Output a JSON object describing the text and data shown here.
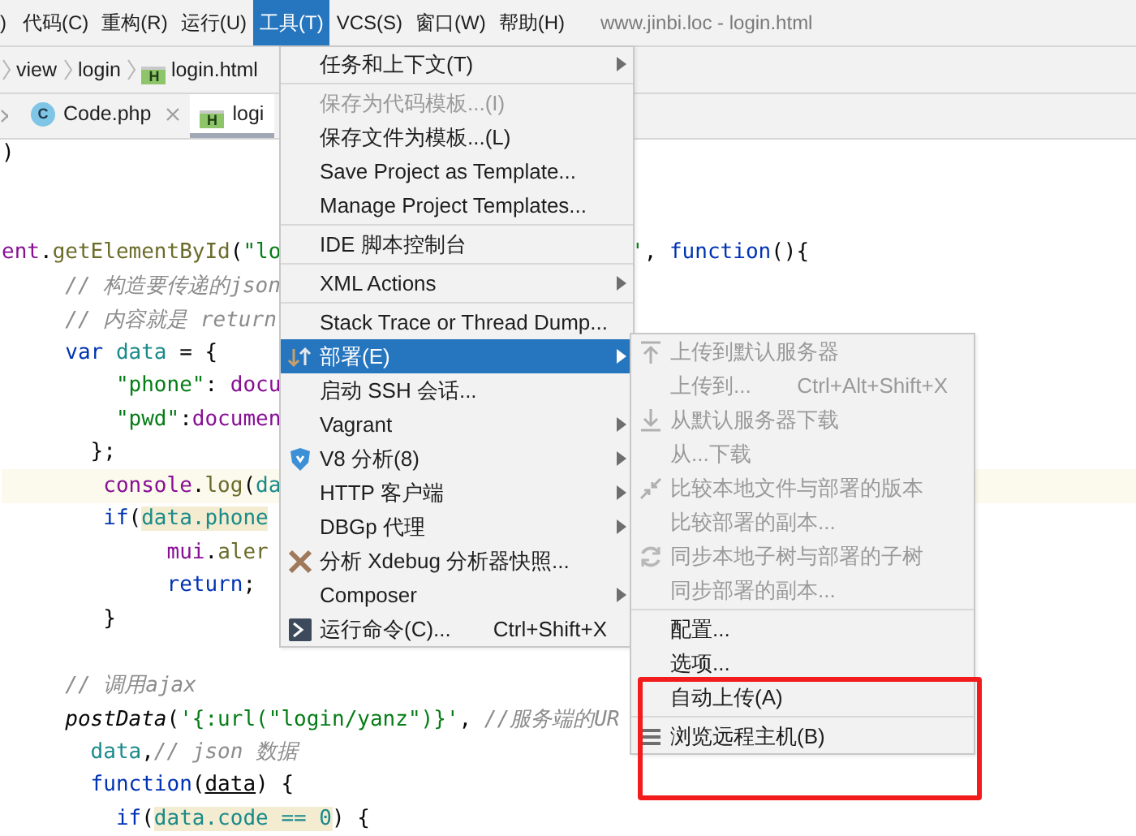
{
  "menubar": {
    "items": [
      {
        "label": ")",
        "selected": false
      },
      {
        "label": "代码(C)",
        "selected": false
      },
      {
        "label": "重构(R)",
        "selected": false
      },
      {
        "label": "运行(U)",
        "selected": false
      },
      {
        "label": "工具(T)",
        "selected": true
      },
      {
        "label": "VCS(S)",
        "selected": false
      },
      {
        "label": "窗口(W)",
        "selected": false
      },
      {
        "label": "帮助(H)",
        "selected": false
      }
    ],
    "title": "www.jinbi.loc - login.html"
  },
  "breadcrumb": [
    {
      "label": "view"
    },
    {
      "label": "login"
    },
    {
      "label": "login.html",
      "badge": "H"
    }
  ],
  "tabs_cut_close": true,
  "tabs": [
    {
      "label": "Code.php",
      "badge": "C",
      "kind": "php",
      "selected": false
    },
    {
      "label": "logi",
      "badge": "H",
      "kind": "html",
      "selected": true
    }
  ],
  "lines": [
    {
      "current": false,
      "segments": [
        {
          "text": ")",
          "kind": "plain"
        }
      ]
    },
    {
      "current": false
    },
    {
      "current": false
    },
    {
      "current": false,
      "segments": [
        {
          "text": "ent",
          "kind": "object"
        },
        {
          "text": ".",
          "kind": "plain"
        },
        {
          "text": "getElementById",
          "kind": "method"
        },
        {
          "text": "(",
          "kind": "plain"
        },
        {
          "text": "\"lo",
          "kind": "string"
        }
      ],
      "tail": [
        {
          "text": "'",
          "kind": "string"
        },
        {
          "text": ", ",
          "kind": "plain"
        },
        {
          "text": "function",
          "kind": "keyword"
        },
        {
          "text": "(){",
          "kind": "plain"
        }
      ]
    },
    {
      "current": false,
      "segments": [
        {
          "text": "     // 构造要传递的json",
          "kind": "comment"
        }
      ]
    },
    {
      "current": false,
      "segments": [
        {
          "text": "     // 内容就是 return",
          "kind": "comment"
        }
      ]
    },
    {
      "current": false,
      "segments": [
        {
          "text": "     var",
          "kind": "keyword"
        },
        {
          "text": " data",
          "kind": "variable"
        },
        {
          "text": " = {",
          "kind": "plain"
        }
      ]
    },
    {
      "current": false,
      "segments": [
        {
          "text": "         \"phone\"",
          "kind": "string"
        },
        {
          "text": ": ",
          "kind": "plain"
        },
        {
          "text": "docu",
          "kind": "object"
        }
      ]
    },
    {
      "current": false,
      "segments": [
        {
          "text": "         \"pwd\"",
          "kind": "string"
        },
        {
          "text": ":",
          "kind": "plain"
        },
        {
          "text": "documen",
          "kind": "object"
        }
      ]
    },
    {
      "current": false,
      "segments": [
        {
          "text": "       };",
          "kind": "plain"
        }
      ]
    },
    {
      "current": true,
      "segments": [
        {
          "text": "        console",
          "kind": "object"
        },
        {
          "text": ".",
          "kind": "plain"
        },
        {
          "text": "log",
          "kind": "method"
        },
        {
          "text": "(",
          "kind": "plain"
        },
        {
          "text": "da",
          "kind": "variable"
        }
      ]
    },
    {
      "current": false,
      "segments": [
        {
          "text": "        if",
          "kind": "keyword"
        },
        {
          "text": "(",
          "kind": "plain"
        },
        {
          "text": "data.phone",
          "kind": "match"
        }
      ]
    },
    {
      "current": false,
      "segments": [
        {
          "text": "             mui",
          "kind": "object"
        },
        {
          "text": ".",
          "kind": "plain"
        },
        {
          "text": "aler",
          "kind": "method"
        }
      ]
    },
    {
      "current": false,
      "segments": [
        {
          "text": "             return",
          "kind": "keyword"
        },
        {
          "text": ";",
          "kind": "plain"
        }
      ]
    },
    {
      "current": false,
      "segments": [
        {
          "text": "        }",
          "kind": "plain"
        }
      ]
    },
    {
      "current": false
    },
    {
      "current": false,
      "segments": [
        {
          "text": "     // 调用ajax",
          "kind": "comment"
        }
      ]
    },
    {
      "current": false,
      "segments": [
        {
          "text": "     postData",
          "kind": "function"
        },
        {
          "text": "(",
          "kind": "plain"
        },
        {
          "text": "'{:url(\"login/yanz\")}'",
          "kind": "string"
        },
        {
          "text": ", ",
          "kind": "plain"
        },
        {
          "text": "//服务端的UR",
          "kind": "comment"
        }
      ]
    },
    {
      "current": false,
      "segments": [
        {
          "text": "       data",
          "kind": "variable"
        },
        {
          "text": ",",
          "kind": "plain"
        },
        {
          "text": "// json 数据",
          "kind": "comment"
        }
      ]
    },
    {
      "current": false,
      "segments": [
        {
          "text": "       function",
          "kind": "keyword"
        },
        {
          "text": "(",
          "kind": "plain"
        },
        {
          "text": "data",
          "kind": "param"
        },
        {
          "text": ") {",
          "kind": "plain"
        }
      ]
    },
    {
      "current": false,
      "segments": [
        {
          "text": "         if",
          "kind": "keyword"
        },
        {
          "text": "(",
          "kind": "plain"
        },
        {
          "text": "data.code == 0",
          "kind": "match"
        },
        {
          "text": ") {",
          "kind": "plain"
        }
      ]
    }
  ],
  "tools_menu": [
    {
      "kind": "item",
      "label": "任务和上下文(T)",
      "disabled": false,
      "selected": false,
      "has_submenu": true
    },
    {
      "kind": "separator"
    },
    {
      "kind": "item",
      "label": "保存为代码模板...(I)",
      "disabled": true,
      "selected": false,
      "has_submenu": false
    },
    {
      "kind": "item",
      "label": "保存文件为模板...(L)",
      "disabled": false,
      "selected": false,
      "has_submenu": false
    },
    {
      "kind": "item",
      "label": "Save Project as Template...",
      "disabled": false,
      "selected": false,
      "has_submenu": false
    },
    {
      "kind": "item",
      "label": "Manage Project Templates...",
      "disabled": false,
      "selected": false,
      "has_submenu": false
    },
    {
      "kind": "separator"
    },
    {
      "kind": "item",
      "label": "IDE 脚本控制台",
      "disabled": false,
      "selected": false,
      "has_submenu": false
    },
    {
      "kind": "separator"
    },
    {
      "kind": "item",
      "label": "XML Actions",
      "disabled": false,
      "selected": false,
      "has_submenu": true
    },
    {
      "kind": "separator"
    },
    {
      "kind": "item",
      "label": "Stack Trace or Thread Dump...",
      "disabled": false,
      "selected": false,
      "has_submenu": false
    },
    {
      "kind": "deploy",
      "label": "部署(E)",
      "disabled": false,
      "selected": true,
      "has_submenu": true
    },
    {
      "kind": "item",
      "label": "启动 SSH 会话...",
      "disabled": false,
      "selected": false,
      "has_submenu": false
    },
    {
      "kind": "item",
      "label": "Vagrant",
      "disabled": false,
      "selected": false,
      "has_submenu": true
    },
    {
      "kind": "profiler",
      "label": "V8 分析(8)",
      "disabled": false,
      "selected": false,
      "has_submenu": true
    },
    {
      "kind": "item",
      "label": "HTTP 客户端",
      "disabled": false,
      "selected": false,
      "has_submenu": true
    },
    {
      "kind": "item",
      "label": "DBGp 代理",
      "disabled": false,
      "selected": false,
      "has_submenu": true
    },
    {
      "kind": "xdebug",
      "label": "分析 Xdebug 分析器快照...",
      "disabled": false,
      "selected": false,
      "has_submenu": false
    },
    {
      "kind": "item",
      "label": "Composer",
      "disabled": false,
      "selected": false,
      "has_submenu": true
    },
    {
      "kind": "terminal",
      "label": "运行命令(C)...",
      "shortcut": "Ctrl+Shift+X",
      "disabled": false,
      "selected": false,
      "has_submenu": false
    }
  ],
  "deploy_menu": [
    {
      "kind": "upload",
      "label": "上传到默认服务器",
      "disabled": true,
      "selected": false,
      "has_submenu": false
    },
    {
      "kind": "item",
      "label": "上传到...",
      "shortcut": "Ctrl+Alt+Shift+X",
      "disabled": true,
      "selected": false,
      "has_submenu": false
    },
    {
      "kind": "download",
      "label": "从默认服务器下载",
      "disabled": true,
      "selected": false,
      "has_submenu": false
    },
    {
      "kind": "item",
      "label": "从...下载",
      "disabled": true,
      "selected": false,
      "has_submenu": false
    },
    {
      "kind": "compare",
      "label": "比较本地文件与部署的版本",
      "disabled": true,
      "selected": false,
      "has_submenu": false
    },
    {
      "kind": "item",
      "label": "比较部署的副本...",
      "disabled": true,
      "selected": false,
      "has_submenu": false
    },
    {
      "kind": "sync",
      "label": "同步本地子树与部署的子树",
      "disabled": true,
      "selected": false,
      "has_submenu": false
    },
    {
      "kind": "item",
      "label": "同步部署的副本...",
      "disabled": true,
      "selected": false,
      "has_submenu": false
    },
    {
      "kind": "separator"
    },
    {
      "kind": "item",
      "label": "配置...",
      "disabled": false,
      "selected": false,
      "has_submenu": false
    },
    {
      "kind": "item",
      "label": "选项...",
      "disabled": false,
      "selected": false,
      "has_submenu": false
    },
    {
      "kind": "item",
      "label": "自动上传(A)",
      "disabled": false,
      "selected": false,
      "has_submenu": false
    },
    {
      "kind": "separator"
    },
    {
      "kind": "browse",
      "label": "浏览远程主机(B)",
      "disabled": false,
      "selected": false,
      "has_submenu": false
    }
  ],
  "annotation_box": true
}
